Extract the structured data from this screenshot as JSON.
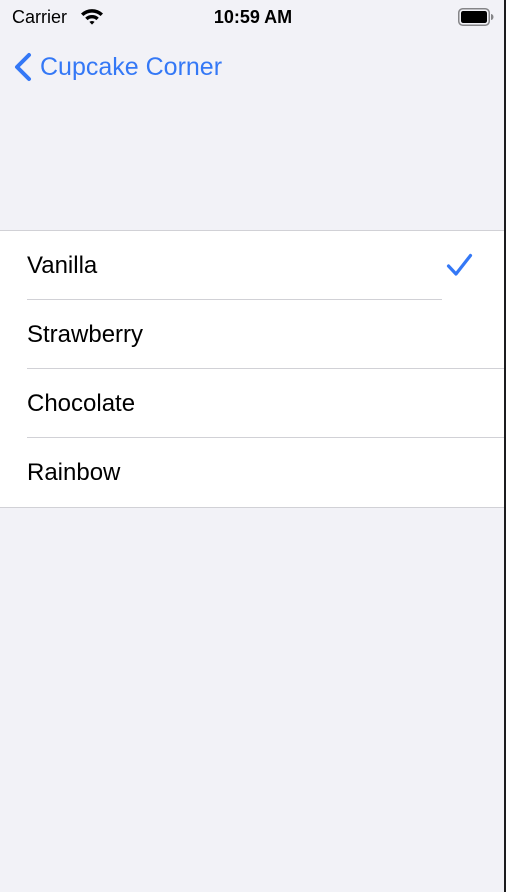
{
  "status_bar": {
    "carrier": "Carrier",
    "time": "10:59 AM"
  },
  "nav": {
    "back_label": "Cupcake Corner"
  },
  "flavors": [
    {
      "label": "Vanilla",
      "selected": true
    },
    {
      "label": "Strawberry",
      "selected": false
    },
    {
      "label": "Chocolate",
      "selected": false
    },
    {
      "label": "Rainbow",
      "selected": false
    }
  ],
  "colors": {
    "accent": "#3478f6",
    "background": "#f2f2f7",
    "cell": "#ffffff",
    "separator": "#d1d1d6"
  }
}
